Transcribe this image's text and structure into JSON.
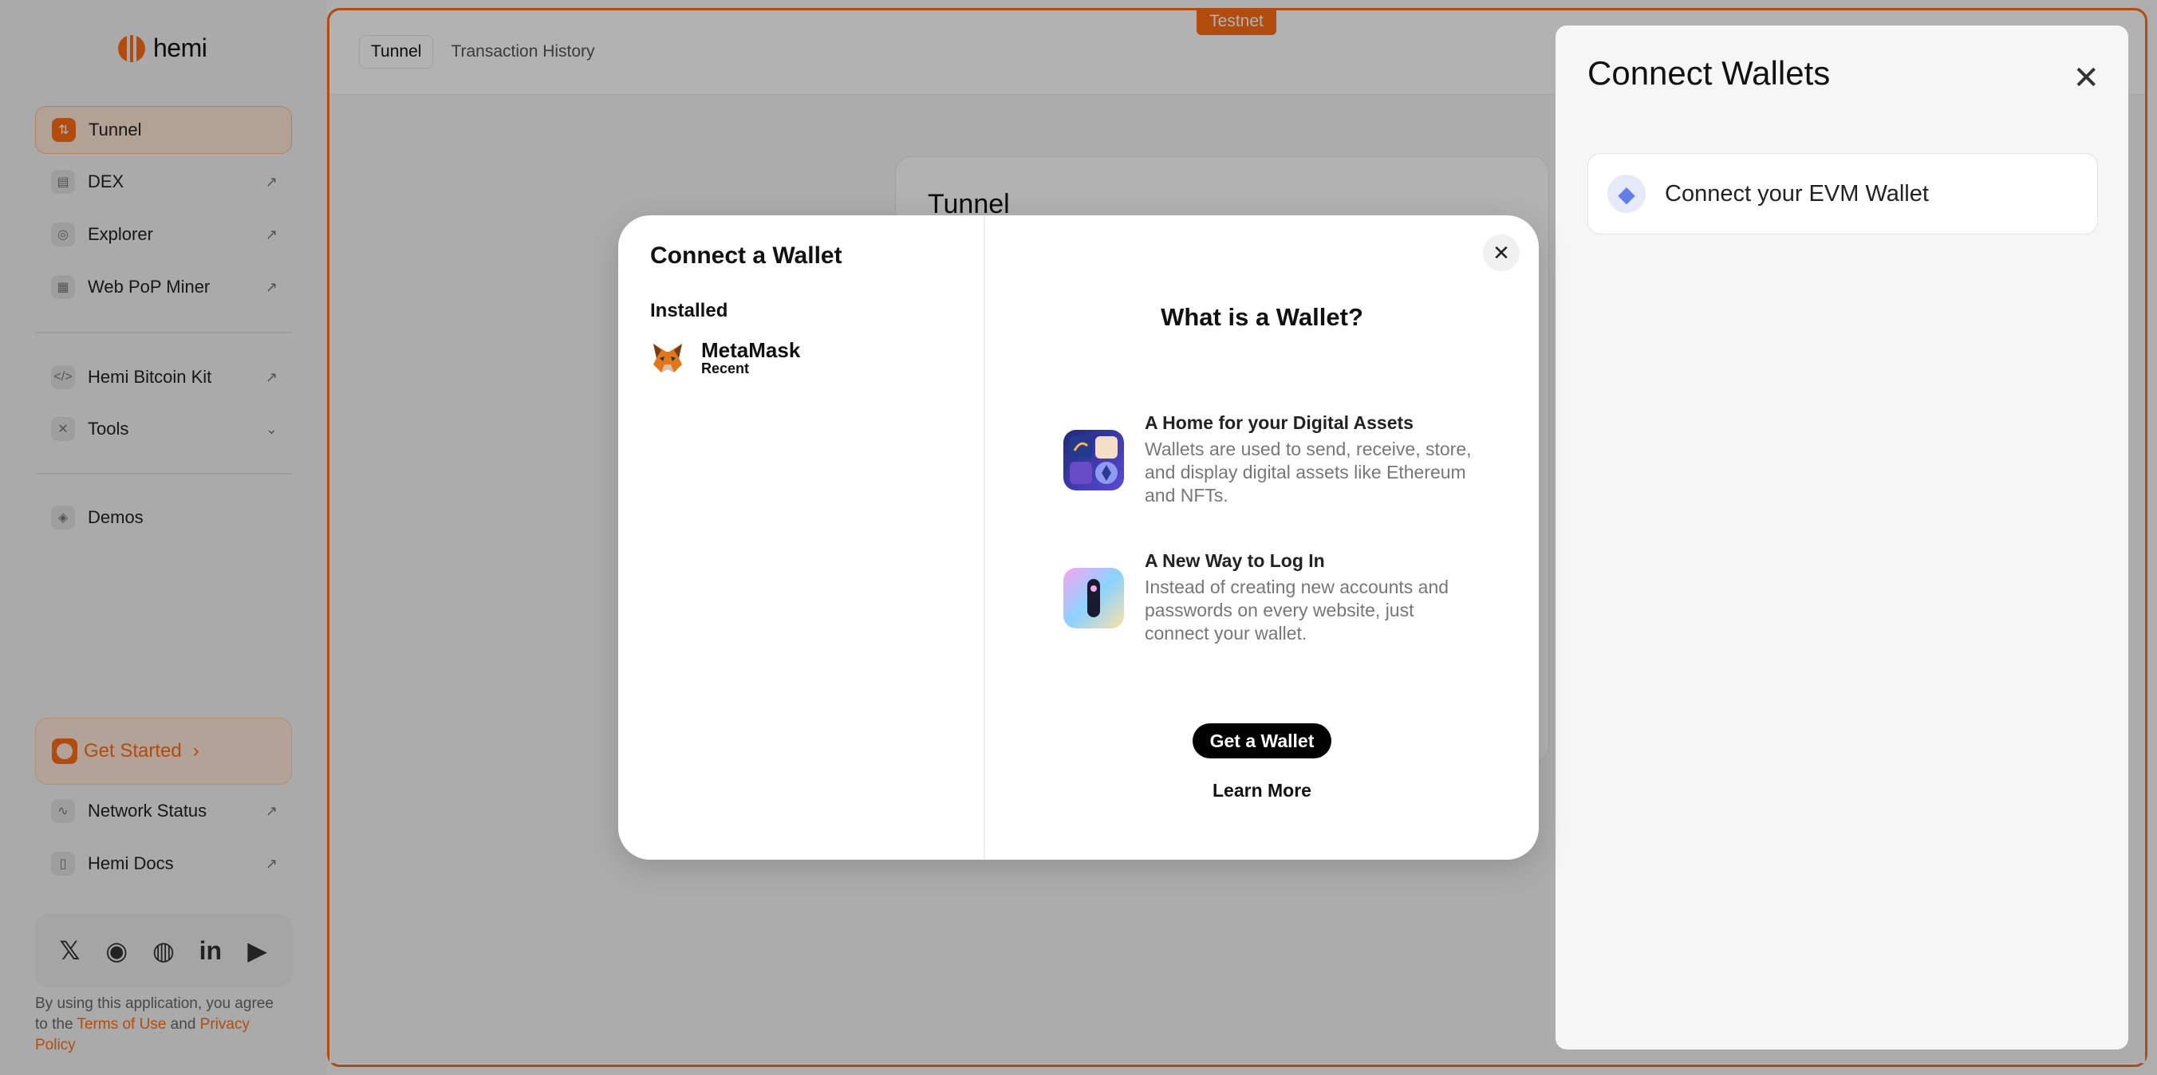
{
  "brand": {
    "name": "hemi"
  },
  "sidebar": {
    "items": [
      {
        "label": "Tunnel",
        "active": true
      },
      {
        "label": "DEX",
        "external": true
      },
      {
        "label": "Explorer",
        "external": true
      },
      {
        "label": "Web PoP Miner",
        "external": true
      },
      {
        "label": "Hemi Bitcoin Kit",
        "external": true
      },
      {
        "label": "Tools",
        "dropdown": true
      },
      {
        "label": "Demos"
      }
    ],
    "get_started": "Get Started",
    "bottom_items": [
      {
        "label": "Network Status"
      },
      {
        "label": "Hemi Docs"
      }
    ],
    "socials": [
      "x-icon",
      "discord-icon",
      "github-icon",
      "linkedin-icon",
      "youtube-icon"
    ],
    "legal": {
      "prefix": "By using this application, you agree to the ",
      "terms": "Terms of Use",
      "and": " and ",
      "privacy": "Privacy Policy"
    }
  },
  "header": {
    "badge": "Testnet",
    "tabs": [
      "Tunnel",
      "Transaction History"
    ]
  },
  "tunnel_card": {
    "title": "Tunnel"
  },
  "drawer": {
    "title": "Connect Wallets",
    "evm_button": "Connect your EVM Wallet"
  },
  "modal": {
    "title": "Connect a Wallet",
    "section": "Installed",
    "wallet": {
      "name": "MetaMask",
      "tag": "Recent"
    },
    "info_title": "What is a Wallet?",
    "features": [
      {
        "title": "A Home for your Digital Assets",
        "desc": "Wallets are used to send, receive, store, and display digital assets like Ethereum and NFTs."
      },
      {
        "title": "A New Way to Log In",
        "desc": "Instead of creating new accounts and passwords on every website, just connect your wallet."
      }
    ],
    "get_wallet": "Get a Wallet",
    "learn_more": "Learn More"
  },
  "colors": {
    "accent": "#ff6c15",
    "overlay": "rgba(0,0,0,0.30)"
  }
}
